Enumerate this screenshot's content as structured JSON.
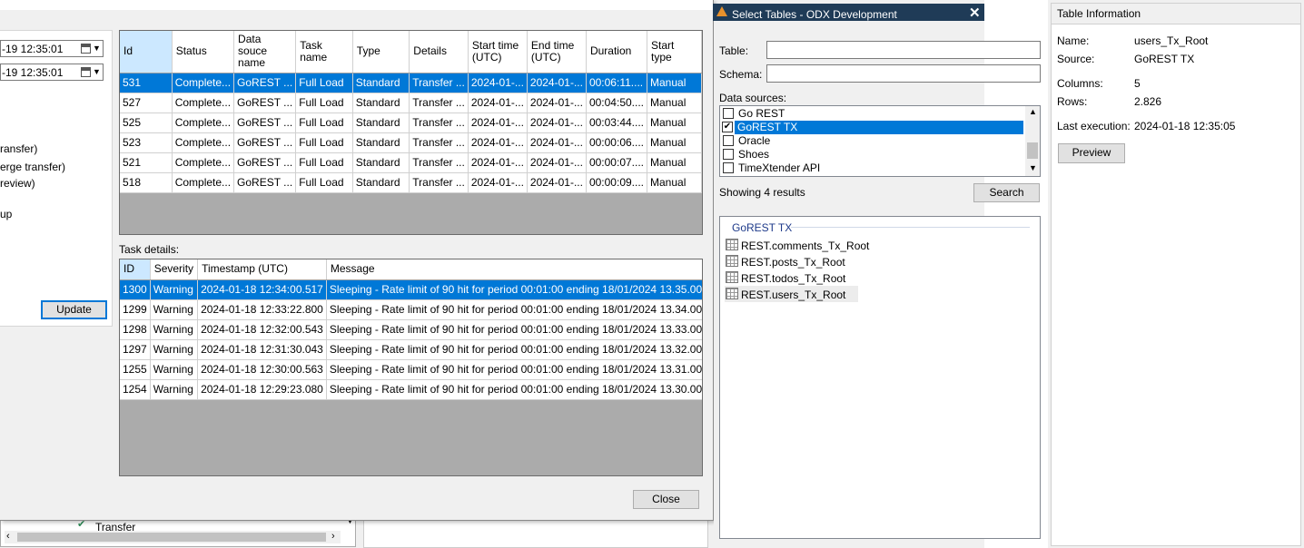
{
  "exec_dialog": {
    "from_date": "-19 12:35:01",
    "to_date": "-19 12:35:01",
    "options": [
      "ransfer)",
      "erge transfer)",
      "review)",
      "up"
    ],
    "update_label": "Update",
    "task_details_label": "Task details:",
    "close_label": "Close",
    "tree_item_label": "Transfer"
  },
  "executions": {
    "columns": [
      "Id",
      "Status",
      "Data souce name",
      "Task name",
      "Type",
      "Details",
      "Start time (UTC)",
      "End time (UTC)",
      "Duration",
      "Start type"
    ],
    "rows": [
      [
        "531",
        "Complete...",
        "GoREST ...",
        "Full Load",
        "Standard",
        "Transfer ...",
        "2024-01-...",
        "2024-01-...",
        "00:06:11....",
        "Manual"
      ],
      [
        "527",
        "Complete...",
        "GoREST ...",
        "Full Load",
        "Standard",
        "Transfer ...",
        "2024-01-...",
        "2024-01-...",
        "00:04:50....",
        "Manual"
      ],
      [
        "525",
        "Complete...",
        "GoREST ...",
        "Full Load",
        "Standard",
        "Transfer ...",
        "2024-01-...",
        "2024-01-...",
        "00:03:44....",
        "Manual"
      ],
      [
        "523",
        "Complete...",
        "GoREST ...",
        "Full Load",
        "Standard",
        "Transfer ...",
        "2024-01-...",
        "2024-01-...",
        "00:00:06....",
        "Manual"
      ],
      [
        "521",
        "Complete...",
        "GoREST ...",
        "Full Load",
        "Standard",
        "Transfer ...",
        "2024-01-...",
        "2024-01-...",
        "00:00:07....",
        "Manual"
      ],
      [
        "518",
        "Complete...",
        "GoREST ...",
        "Full Load",
        "Standard",
        "Transfer ...",
        "2024-01-...",
        "2024-01-...",
        "00:00:09....",
        "Manual"
      ]
    ]
  },
  "task_details": {
    "columns": [
      "ID",
      "Severity",
      "Timestamp (UTC)",
      "Message"
    ],
    "rows": [
      [
        "1300",
        "Warning",
        "2024-01-18 12:34:00.517",
        "Sleeping - Rate limit of 90 hit for period 00:01:00 ending 18/01/2024 13.35.00"
      ],
      [
        "1299",
        "Warning",
        "2024-01-18 12:33:22.800",
        "Sleeping - Rate limit of 90 hit for period 00:01:00 ending 18/01/2024 13.34.00"
      ],
      [
        "1298",
        "Warning",
        "2024-01-18 12:32:00.543",
        "Sleeping - Rate limit of 90 hit for period 00:01:00 ending 18/01/2024 13.33.00"
      ],
      [
        "1297",
        "Warning",
        "2024-01-18 12:31:30.043",
        "Sleeping - Rate limit of 90 hit for period 00:01:00 ending 18/01/2024 13.32.00"
      ],
      [
        "1255",
        "Warning",
        "2024-01-18 12:30:00.563",
        "Sleeping - Rate limit of 90 hit for period 00:01:00 ending 18/01/2024 13.31.00"
      ],
      [
        "1254",
        "Warning",
        "2024-01-18 12:29:23.080",
        "Sleeping - Rate limit of 90 hit for period 00:01:00 ending 18/01/2024 13.30.00"
      ]
    ]
  },
  "select_tables": {
    "title": "Select Tables - ODX Development",
    "table_label": "Table:",
    "schema_label": "Schema:",
    "data_sources_label": "Data sources:",
    "data_sources": [
      {
        "label": "Go REST",
        "checked": false
      },
      {
        "label": "GoREST TX",
        "checked": true
      },
      {
        "label": "Oracle",
        "checked": false
      },
      {
        "label": "Shoes",
        "checked": false
      },
      {
        "label": "TimeXtender API",
        "checked": false
      }
    ],
    "results_text": "Showing 4 results",
    "search_label": "Search",
    "group_label": "GoREST TX",
    "tables": [
      "REST.comments_Tx_Root",
      "REST.posts_Tx_Root",
      "REST.todos_Tx_Root",
      "REST.users_Tx_Root"
    ]
  },
  "table_info": {
    "title": "Table Information",
    "name_label": "Name:",
    "name_value": "users_Tx_Root",
    "source_label": "Source:",
    "source_value": "GoREST TX",
    "columns_label": "Columns:",
    "columns_value": "5",
    "rows_label": "Rows:",
    "rows_value": "2.826",
    "last_exec_label": "Last execution:",
    "last_exec_value": "2024-01-18 12:35:05",
    "preview_label": "Preview"
  },
  "colors": {
    "selection": "#0078d7",
    "title_bar": "#1f3b57",
    "grid_empty": "#ababab",
    "header_selected": "#cce8ff"
  }
}
